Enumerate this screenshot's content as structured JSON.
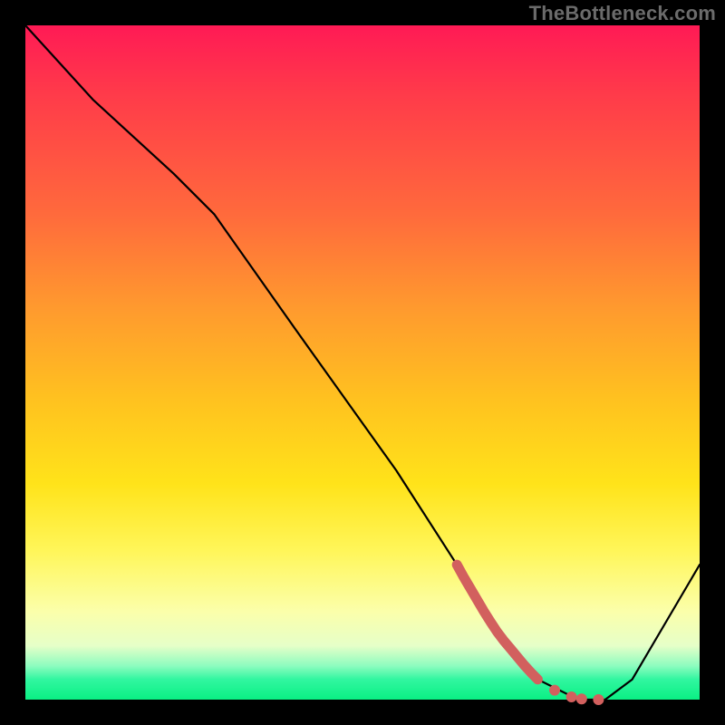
{
  "watermark": "TheBottleneck.com",
  "chart_data": {
    "type": "line",
    "title": "",
    "xlabel": "",
    "ylabel": "",
    "xlim": [
      0,
      100
    ],
    "ylim": [
      0,
      100
    ],
    "series": [
      {
        "name": "bottleneck-curve",
        "x": [
          0,
          10,
          22,
          28,
          40,
          55,
          64,
          70,
          76,
          82,
          86,
          90,
          100
        ],
        "values": [
          100,
          89,
          78,
          72,
          55,
          34,
          20,
          10,
          3,
          0,
          0,
          3,
          20
        ]
      }
    ],
    "markers": {
      "name": "optimal-range-ticks",
      "style": "coral-dots",
      "points": [
        {
          "x": 64.0,
          "y": 20.0
        },
        {
          "x": 65.0,
          "y": 18.2
        },
        {
          "x": 66.0,
          "y": 16.5
        },
        {
          "x": 67.0,
          "y": 14.8
        },
        {
          "x": 68.0,
          "y": 13.1
        },
        {
          "x": 69.0,
          "y": 11.5
        },
        {
          "x": 70.0,
          "y": 10.0
        },
        {
          "x": 71.0,
          "y": 8.7
        },
        {
          "x": 72.0,
          "y": 7.5
        },
        {
          "x": 73.0,
          "y": 6.3
        },
        {
          "x": 74.0,
          "y": 5.1
        },
        {
          "x": 75.0,
          "y": 4.0
        },
        {
          "x": 76.0,
          "y": 3.0
        },
        {
          "x": 78.5,
          "y": 1.4
        },
        {
          "x": 81.0,
          "y": 0.4
        },
        {
          "x": 82.5,
          "y": 0.1
        },
        {
          "x": 85.0,
          "y": 0.0
        }
      ]
    },
    "gradient_stops": [
      {
        "pos": 0,
        "color": "#ff1a55"
      },
      {
        "pos": 10,
        "color": "#ff3a4a"
      },
      {
        "pos": 28,
        "color": "#ff6a3c"
      },
      {
        "pos": 42,
        "color": "#ff9a2e"
      },
      {
        "pos": 56,
        "color": "#ffc31f"
      },
      {
        "pos": 68,
        "color": "#ffe31a"
      },
      {
        "pos": 78,
        "color": "#fff65a"
      },
      {
        "pos": 87,
        "color": "#fbffab"
      },
      {
        "pos": 92,
        "color": "#e6ffc8"
      },
      {
        "pos": 95,
        "color": "#8dfcbf"
      },
      {
        "pos": 97,
        "color": "#31f6a0"
      },
      {
        "pos": 100,
        "color": "#0af084"
      }
    ]
  }
}
